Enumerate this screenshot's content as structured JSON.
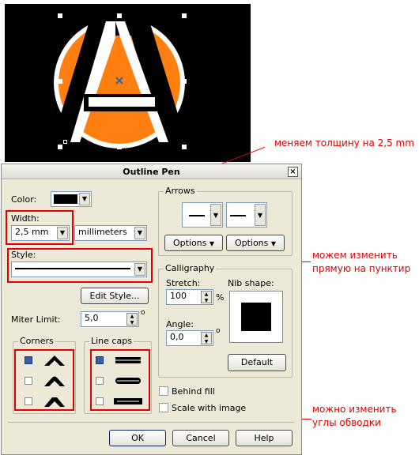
{
  "annotations": {
    "width_note": "меняем толщину на 2,5 mm",
    "style_note": "можем изменить прямую на пунктир",
    "corners_note": "можно изменить углы обводки",
    "color": "#e00000"
  },
  "dialog": {
    "title": "Outline Pen",
    "close_symbol": "×",
    "color_label": "Color:",
    "color_value": "#000000",
    "width_label": "Width:",
    "width_value": "2,5 mm",
    "units_value": "millimeters",
    "style_label": "Style:",
    "edit_style_button": "Edit Style...",
    "miter_label": "Miter Limit:",
    "miter_value": "5,0",
    "degree_symbol": "o",
    "corners_title": "Corners",
    "line_caps_title": "Line caps",
    "arrows_title": "Arrows",
    "options_left": "Options",
    "options_right": "Options",
    "calligraphy_title": "Calligraphy",
    "stretch_label": "Stretch:",
    "stretch_value": "100",
    "percent_symbol": "%",
    "angle_label": "Angle:",
    "angle_value": "0,0",
    "nib_shape_label": "Nib shape:",
    "default_button": "Default",
    "behind_fill_label": "Behind fill",
    "scale_with_image_label": "Scale with image",
    "ok_button": "OK",
    "cancel_button": "Cancel",
    "help_button": "Help",
    "selected_corner": 0,
    "selected_line_cap": 0
  },
  "canvas": {
    "background": "#000000",
    "circle_color": "#ff7f10",
    "letter": "A"
  }
}
